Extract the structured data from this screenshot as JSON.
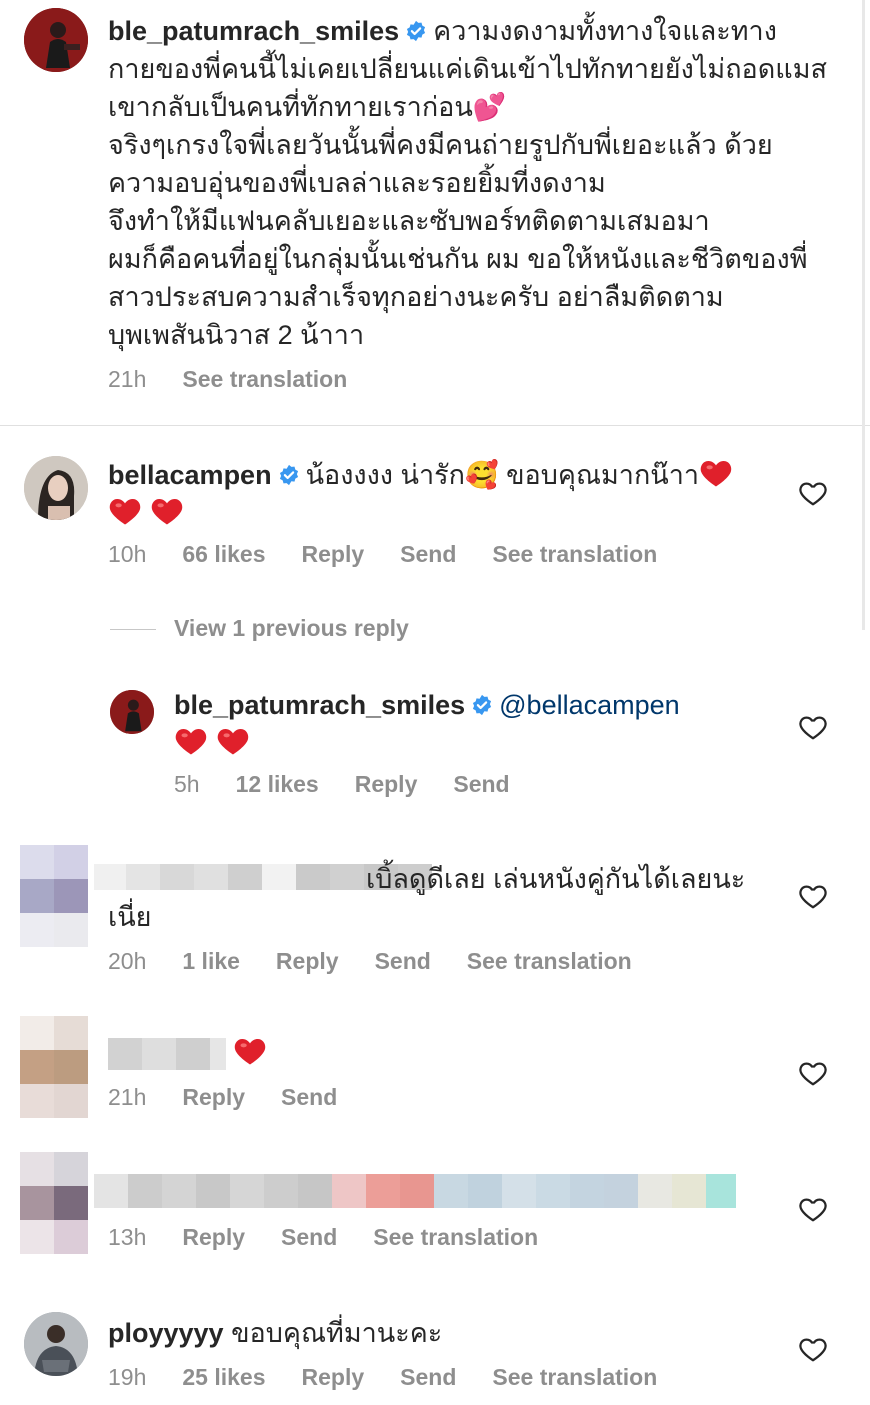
{
  "comments": [
    {
      "username": "ble_patumrach_smiles",
      "lines": [
        "ความงดงามทั้งทางใจและทาง",
        "กายของพี่คนนี้ไม่เคยเปลี่ยนแค่เดินเข้าไปทักทายยังไม่ถอดแมส",
        "เขากลับเป็นคนที่ทักทายเราก่อน💕",
        "จริงๆเกรงใจพี่เลยวันนั้นพี่คงมีคนถ่ายรูปกับพี่เยอะแล้ว ด้วย",
        "ความอบอุ่นของพี่เบลล่าและรอยยิ้มที่งดงาม",
        "จึงทำให้มีแฟนคลับเยอะและซับพอร์ทติดตามเสมอมา",
        "ผมก็คือคนที่อยู่ในกลุ่มนั้นเช่นกัน  ผม ขอให้หนังและชีวิตของพี่",
        "สาวประสบความสำเร็จทุกอย่างนะครับ อย่าลืมติดตาม",
        "บุพเพสันนิวาส 2 น้าาา"
      ],
      "time": "21h",
      "see_translation": "See translation"
    },
    {
      "username": "bellacampen",
      "text": "น้องงงง น่ารัก🥰 ขอบคุณมากน๊าา",
      "time": "10h",
      "likes": "66 likes",
      "reply": "Reply",
      "send": "Send",
      "see_translation": "See translation"
    },
    {
      "view_replies": "View 1 previous reply"
    },
    {
      "username": "ble_patumrach_smiles",
      "mention": "@bellacampen",
      "time": "5h",
      "likes": "12 likes",
      "reply": "Reply",
      "send": "Send"
    },
    {
      "text": "เบิ้ลดูดีเลย เล่นหนังคู่กันได้เลยนะ",
      "text2": "เนี่ย",
      "time": "20h",
      "likes": "1 like",
      "reply": "Reply",
      "send": "Send",
      "see_translation": "See translation"
    },
    {
      "time": "21h",
      "reply": "Reply",
      "send": "Send"
    },
    {
      "time": "13h",
      "reply": "Reply",
      "send": "Send",
      "see_translation": "See translation"
    },
    {
      "username": "ployyyyy",
      "text": "ขอบคุณที่มานะคะ",
      "time": "19h",
      "likes": "25 likes",
      "reply": "Reply",
      "send": "Send",
      "see_translation": "See translation"
    }
  ],
  "icons": {
    "verified": "verified-badge-icon",
    "like": "heart-outline-icon"
  },
  "colors": {
    "verified_blue": "#3897f0",
    "mention": "#00376b",
    "meta_gray": "#8e8e8e",
    "heart_red": "#e0202b"
  }
}
